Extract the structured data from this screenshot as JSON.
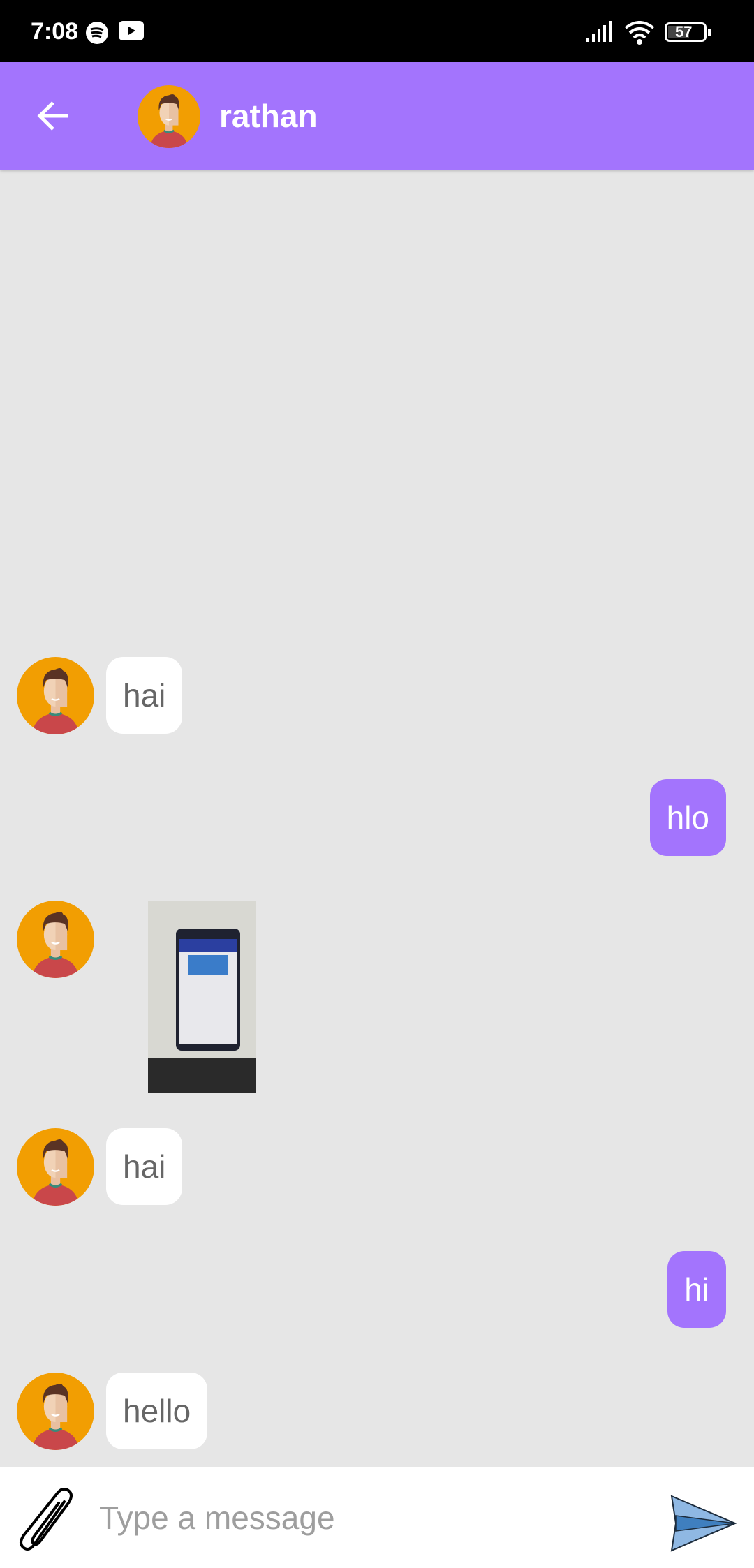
{
  "status_bar": {
    "time": "7:08",
    "battery": "57",
    "icons": [
      "spotify-icon",
      "youtube-icon",
      "signal-icon",
      "wifi-icon",
      "battery-icon"
    ]
  },
  "header": {
    "contact_name": "rathan",
    "back_icon": "arrow-left-icon"
  },
  "messages": [
    {
      "direction": "incoming",
      "type": "text",
      "text": "hai"
    },
    {
      "direction": "outgoing",
      "type": "text",
      "text": "hlo"
    },
    {
      "direction": "incoming",
      "type": "image"
    },
    {
      "direction": "incoming",
      "type": "text",
      "text": "hai"
    },
    {
      "direction": "outgoing",
      "type": "text",
      "text": "hi"
    },
    {
      "direction": "incoming",
      "type": "text",
      "text": "hello"
    }
  ],
  "composer": {
    "placeholder": "Type a message",
    "value": ""
  },
  "colors": {
    "accent": "#a374fd",
    "background": "#e6e6e6",
    "incoming_bubble": "#ffffff"
  }
}
